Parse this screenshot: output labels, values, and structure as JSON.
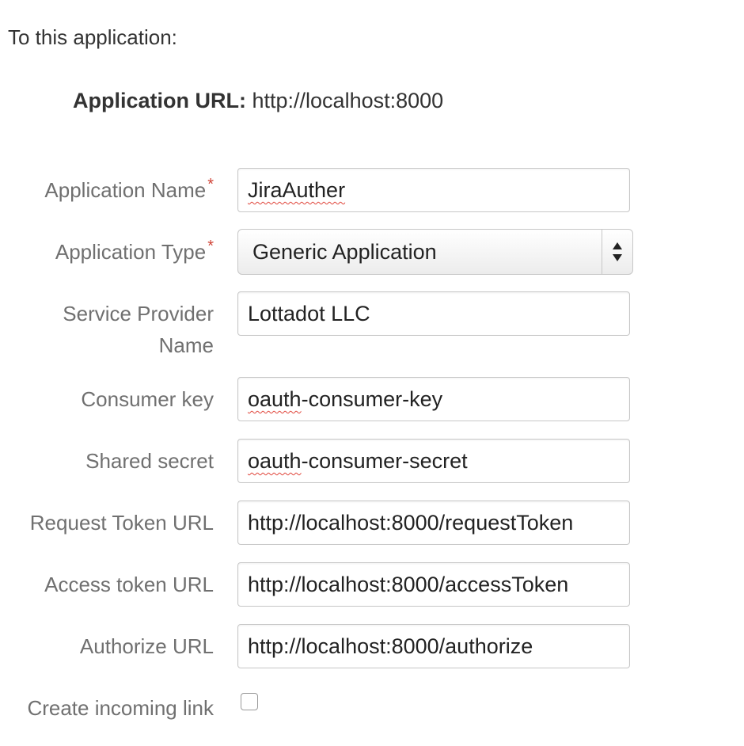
{
  "intro_text": "To this application:",
  "app_url": {
    "label": "Application URL:",
    "value": "http://localhost:8000"
  },
  "required_marker": "*",
  "fields": {
    "application_name": {
      "label": "Application Name",
      "value": "JiraAuther"
    },
    "application_type": {
      "label": "Application Type",
      "value": "Generic Application"
    },
    "service_provider_name": {
      "label": "Service Provider Name",
      "value": "Lottadot LLC"
    },
    "consumer_key": {
      "label": "Consumer key",
      "value_prefix": "oauth",
      "value_rest": "-consumer-key"
    },
    "shared_secret": {
      "label": "Shared secret",
      "value_prefix": "oauth",
      "value_rest": "-consumer-secret"
    },
    "request_token_url": {
      "label": "Request Token URL",
      "value": "http://localhost:8000/requestToken"
    },
    "access_token_url": {
      "label": "Access token URL",
      "value": "http://localhost:8000/accessToken"
    },
    "authorize_url": {
      "label": "Authorize URL",
      "value": "http://localhost:8000/authorize"
    },
    "create_incoming_link": {
      "label": "Create incoming link",
      "checked": false
    }
  },
  "colors": {
    "required": "#d04437",
    "label": "#707070",
    "border": "#c7c7c7",
    "spellcheck": "#e0453b"
  },
  "icons": {
    "select_arrows": "updown-arrows-icon"
  }
}
